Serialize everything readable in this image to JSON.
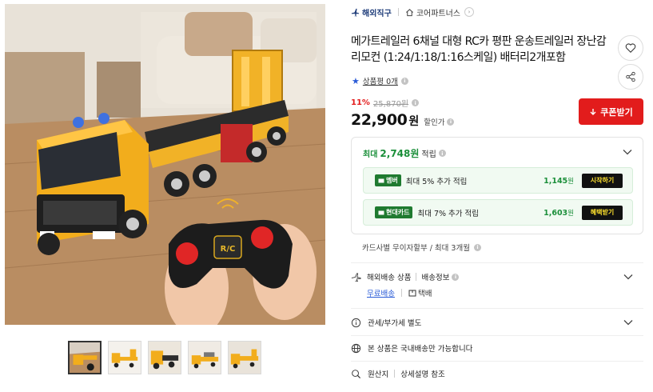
{
  "product": {
    "title": "메가트레일러 6채널 대형 RC카 평판 운송트레일러 장난감 리모컨 (1:24/1:18/1:16스케일) 배터리2개포함",
    "thumbnails_count": 5
  },
  "seller": {
    "ship_badge": "해외직구",
    "store_name": "코어파트너스"
  },
  "review": {
    "label": "상품평 0개"
  },
  "price": {
    "discount_rate": "11%",
    "original": "25,870원",
    "sale_amount": "22,900",
    "sale_unit": "원",
    "sale_tag": "할인가",
    "coupon_button": "쿠폰받기"
  },
  "reward": {
    "head_prefix": "최대",
    "head_amount": "2,748원",
    "head_suffix": "적립",
    "items": [
      {
        "badge": "멤버",
        "desc": "최대 5% 추가 적립",
        "value": "1,145",
        "value_unit": "원",
        "action": "시작하기"
      },
      {
        "badge": "현대카드",
        "desc": "최대 7% 추가 적립",
        "value": "1,603",
        "value_unit": "원",
        "action": "혜택받기"
      }
    ]
  },
  "installment": "카드사별 무이자할부 / 최대 3개월",
  "delivery": {
    "type": "해외배송 상품",
    "info_link": "배송정보",
    "free_label": "무료배송",
    "parcel_label": "택배"
  },
  "customs": "관세/부가세 별도",
  "domestic_notice": "본 상품은 국내배송만 가능합니다",
  "origin": {
    "label": "원산지",
    "value": "상세설명 참조"
  },
  "colors": {
    "accent_red": "#e21c1c",
    "reward_green": "#1b8f3a",
    "link_blue": "#2a5bd7"
  }
}
